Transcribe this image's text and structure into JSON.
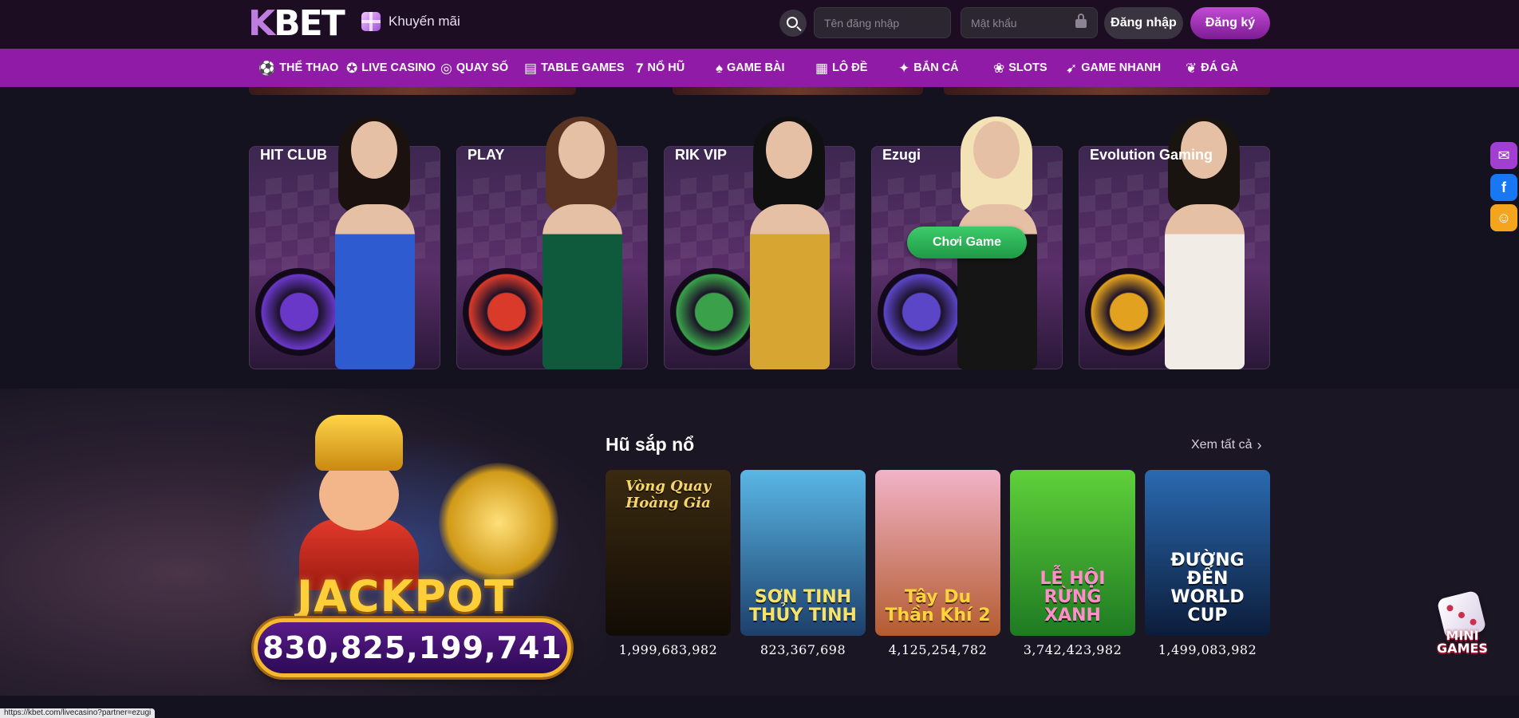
{
  "header": {
    "logo_text_k": "K",
    "logo_text_rest": "BET",
    "promo_label": "Khuyến mãi",
    "username_placeholder": "Tên đăng nhập",
    "password_placeholder": "Mật khẩu",
    "login_label": "Đăng nhập",
    "register_label": "Đăng ký"
  },
  "nav": {
    "items": [
      {
        "label": "THỂ THAO",
        "icon": "soccer-ball-icon",
        "glyph": "⚽"
      },
      {
        "label": "LIVE CASINO",
        "icon": "casino-chip-icon",
        "glyph": "✪"
      },
      {
        "label": "QUAY SỐ",
        "icon": "lottery-wheel-icon",
        "glyph": "◎"
      },
      {
        "label": "TABLE GAMES",
        "icon": "table-games-icon",
        "glyph": "▤"
      },
      {
        "label": "NỔ HŨ",
        "icon": "seven-icon",
        "glyph": "7"
      },
      {
        "label": "GAME BÀI",
        "icon": "cards-icon",
        "glyph": "♠"
      },
      {
        "label": "LÔ ĐỀ",
        "icon": "lottery-ticket-icon",
        "glyph": "▦"
      },
      {
        "label": "BẮN CÁ",
        "icon": "fish-icon",
        "glyph": "✦"
      },
      {
        "label": "SLOTS",
        "icon": "cherry-icon",
        "glyph": "❀"
      },
      {
        "label": "GAME NHANH",
        "icon": "rocket-icon",
        "glyph": "➹"
      },
      {
        "label": "ĐÁ GÀ",
        "icon": "rooster-icon",
        "glyph": "❦"
      }
    ]
  },
  "providers": [
    {
      "name": "HIT CLUB",
      "logo_icon": "hitclub-logo-icon",
      "hair": "#1b1210",
      "dress": "#2f5bd0",
      "prop": "#6a38c9"
    },
    {
      "name": "PLAY",
      "logo_icon": "play-logo-icon",
      "hair": "#5a3420",
      "dress": "#0f5a3c",
      "prop": "#d93a2a"
    },
    {
      "name": "RIK VIP",
      "logo_icon": "rikvip-logo-icon",
      "hair": "#101010",
      "dress": "#d7a532",
      "prop": "#3aa14a"
    },
    {
      "name": "Ezugi",
      "logo_icon": "ezugi-logo-icon",
      "hair": "#f2e2b6",
      "dress": "#151515",
      "prop": "#5b46c8"
    },
    {
      "name": "Evolution Gaming",
      "logo_icon": "evolution-logo-icon",
      "hair": "#1a1410",
      "dress": "#f1ece6",
      "prop": "#e2a11e"
    }
  ],
  "play_button_label": "Chơi Game",
  "jackpot": {
    "word": "JACKPOT",
    "amount": "830,825,199,741"
  },
  "hu_section": {
    "title": "Hũ sắp nổ",
    "see_all": "Xem tất cả",
    "games": [
      {
        "title_top": "Vòng Quay Hoàng Gia",
        "title": "",
        "value": "1,999,683,982",
        "c1": "#3a2a10",
        "c2": "#120c06",
        "color": "#f6d56a"
      },
      {
        "title_top": "",
        "title": "SƠN TINH THỦY TINH",
        "value": "823,367,698",
        "c1": "#5ab7e6",
        "c2": "#1c3f6a",
        "color": "#f7e36a"
      },
      {
        "title_top": "",
        "title": "Tây Du Thần Khí 2",
        "value": "4,125,254,782",
        "c1": "#f1b3c7",
        "c2": "#b45c30",
        "color": "#ffd33a"
      },
      {
        "title_top": "",
        "title": "LỄ HỘI RỪNG XANH",
        "value": "3,742,423,982",
        "c1": "#5fd13a",
        "c2": "#1e7a22",
        "color": "#ff8ec9"
      },
      {
        "title_top": "",
        "title": "ĐƯỜNG ĐẾN WORLD CUP",
        "value": "1,499,083,982",
        "c1": "#2a6ab0",
        "c2": "#0c1c3a",
        "color": "#ffffff"
      }
    ]
  },
  "side_icons": [
    {
      "icon": "chat-icon",
      "color": "#a23ed0",
      "glyph": "✉"
    },
    {
      "icon": "facebook-icon",
      "color": "#1877f2",
      "glyph": "f"
    },
    {
      "icon": "community-icon",
      "color": "#f3a51d",
      "glyph": "☺"
    }
  ],
  "mini_games_label": "MINI GAMES",
  "status_url": "https://kbet.com/livecasino?partner=ezugi"
}
